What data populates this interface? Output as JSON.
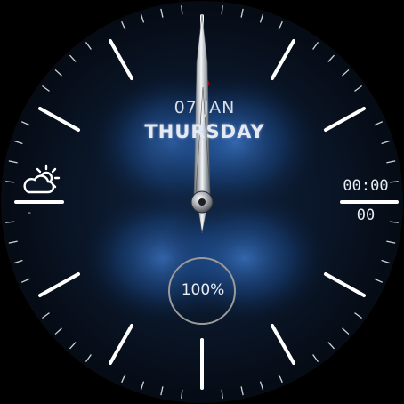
{
  "date": {
    "day_month": "07 JAN",
    "weekday": "THURSDAY"
  },
  "digital_time": {
    "time": "00:00",
    "seconds": "00"
  },
  "weather": {
    "icon": "partly-cloudy-icon",
    "value": "-"
  },
  "battery": {
    "percent_label": "100%",
    "level": 1.0
  },
  "hands": {
    "hour_icon": "hour-hand",
    "minute_icon": "minute-hand",
    "second_icon": "second-hand"
  },
  "colors": {
    "background": "#000000",
    "dial_glow": "#2a5ea8",
    "marker": "#ffffff",
    "second_hand_tip": "#e01010",
    "ring": "#9a9a9a"
  }
}
